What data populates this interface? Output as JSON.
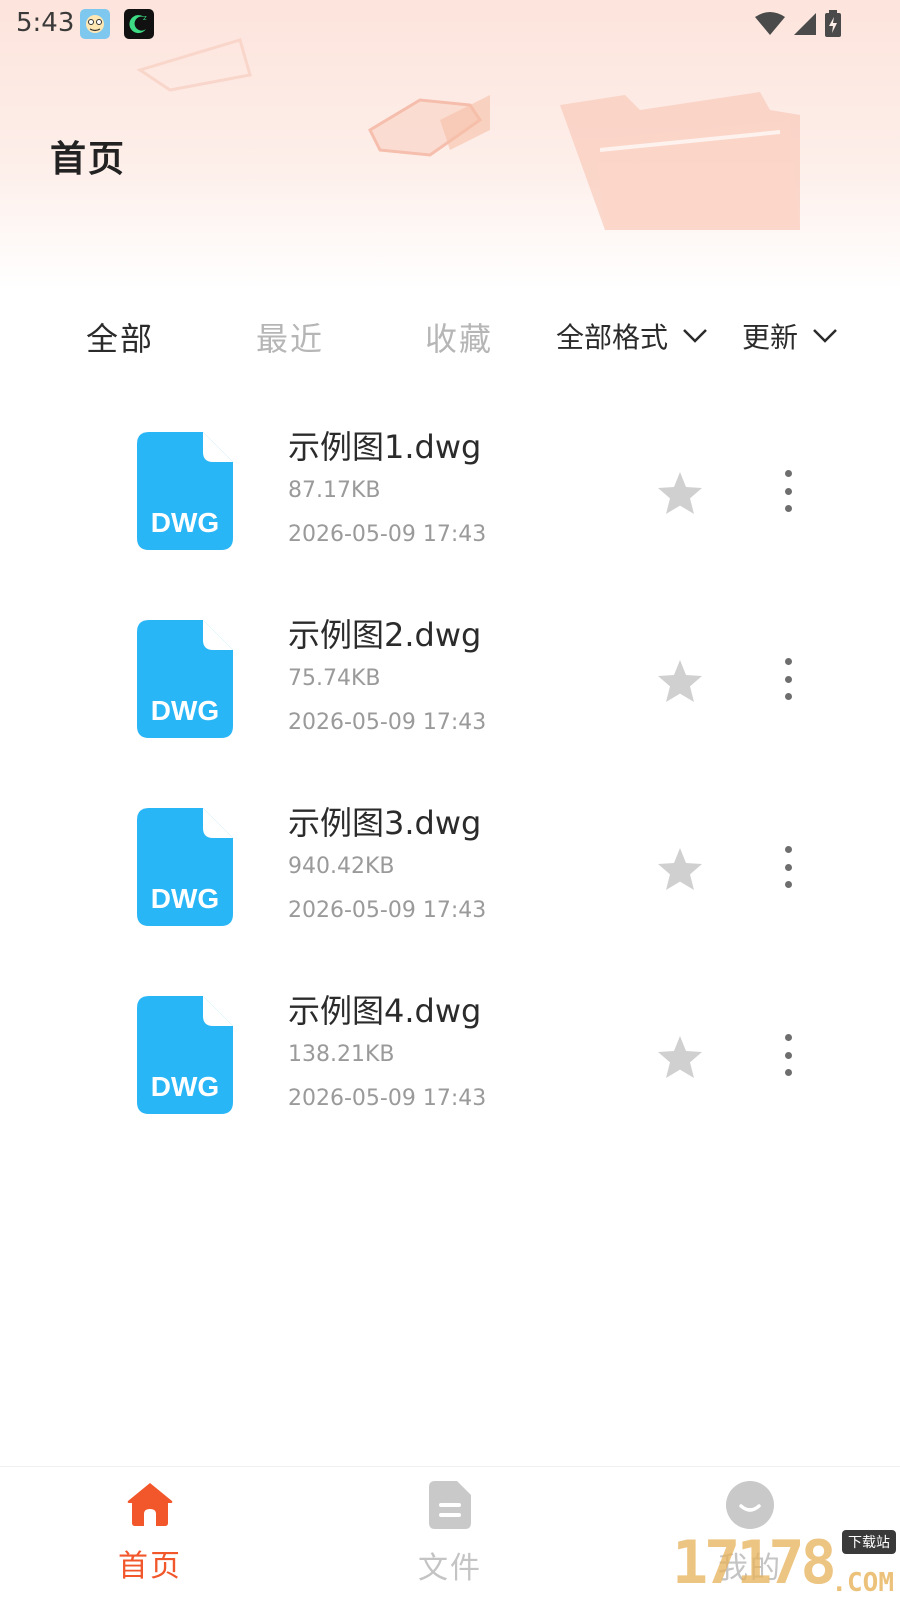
{
  "status_bar": {
    "time": "5:43"
  },
  "header": {
    "title": "首页"
  },
  "tabs": [
    {
      "label": "全部",
      "active": true
    },
    {
      "label": "最近",
      "active": false
    },
    {
      "label": "收藏",
      "active": false
    }
  ],
  "filters": {
    "format_label": "全部格式",
    "sort_label": "更新"
  },
  "files": [
    {
      "name": "示例图1.dwg",
      "size": "87.17KB",
      "date": "2026-05-09 17:43",
      "icon_label": "DWG",
      "starred": false
    },
    {
      "name": "示例图2.dwg",
      "size": "75.74KB",
      "date": "2026-05-09 17:43",
      "icon_label": "DWG",
      "starred": false
    },
    {
      "name": "示例图3.dwg",
      "size": "940.42KB",
      "date": "2026-05-09 17:43",
      "icon_label": "DWG",
      "starred": false
    },
    {
      "name": "示例图4.dwg",
      "size": "138.21KB",
      "date": "2026-05-09 17:43",
      "icon_label": "DWG",
      "starred": false
    }
  ],
  "bottom_nav": [
    {
      "label": "首页",
      "icon": "home-icon",
      "active": true
    },
    {
      "label": "文件",
      "icon": "document-icon",
      "active": false
    },
    {
      "label": "我的",
      "icon": "profile-icon",
      "active": false
    }
  ],
  "watermark": {
    "digits": "17178",
    "tag": "下载站",
    "suffix": ".COM"
  },
  "colors": {
    "accent": "#f2562b",
    "file_icon": "#29b6f6",
    "tab_inactive": "#b6b6b6",
    "meta_text": "#9a9a9a",
    "star_inactive": "#d0d0d0"
  }
}
